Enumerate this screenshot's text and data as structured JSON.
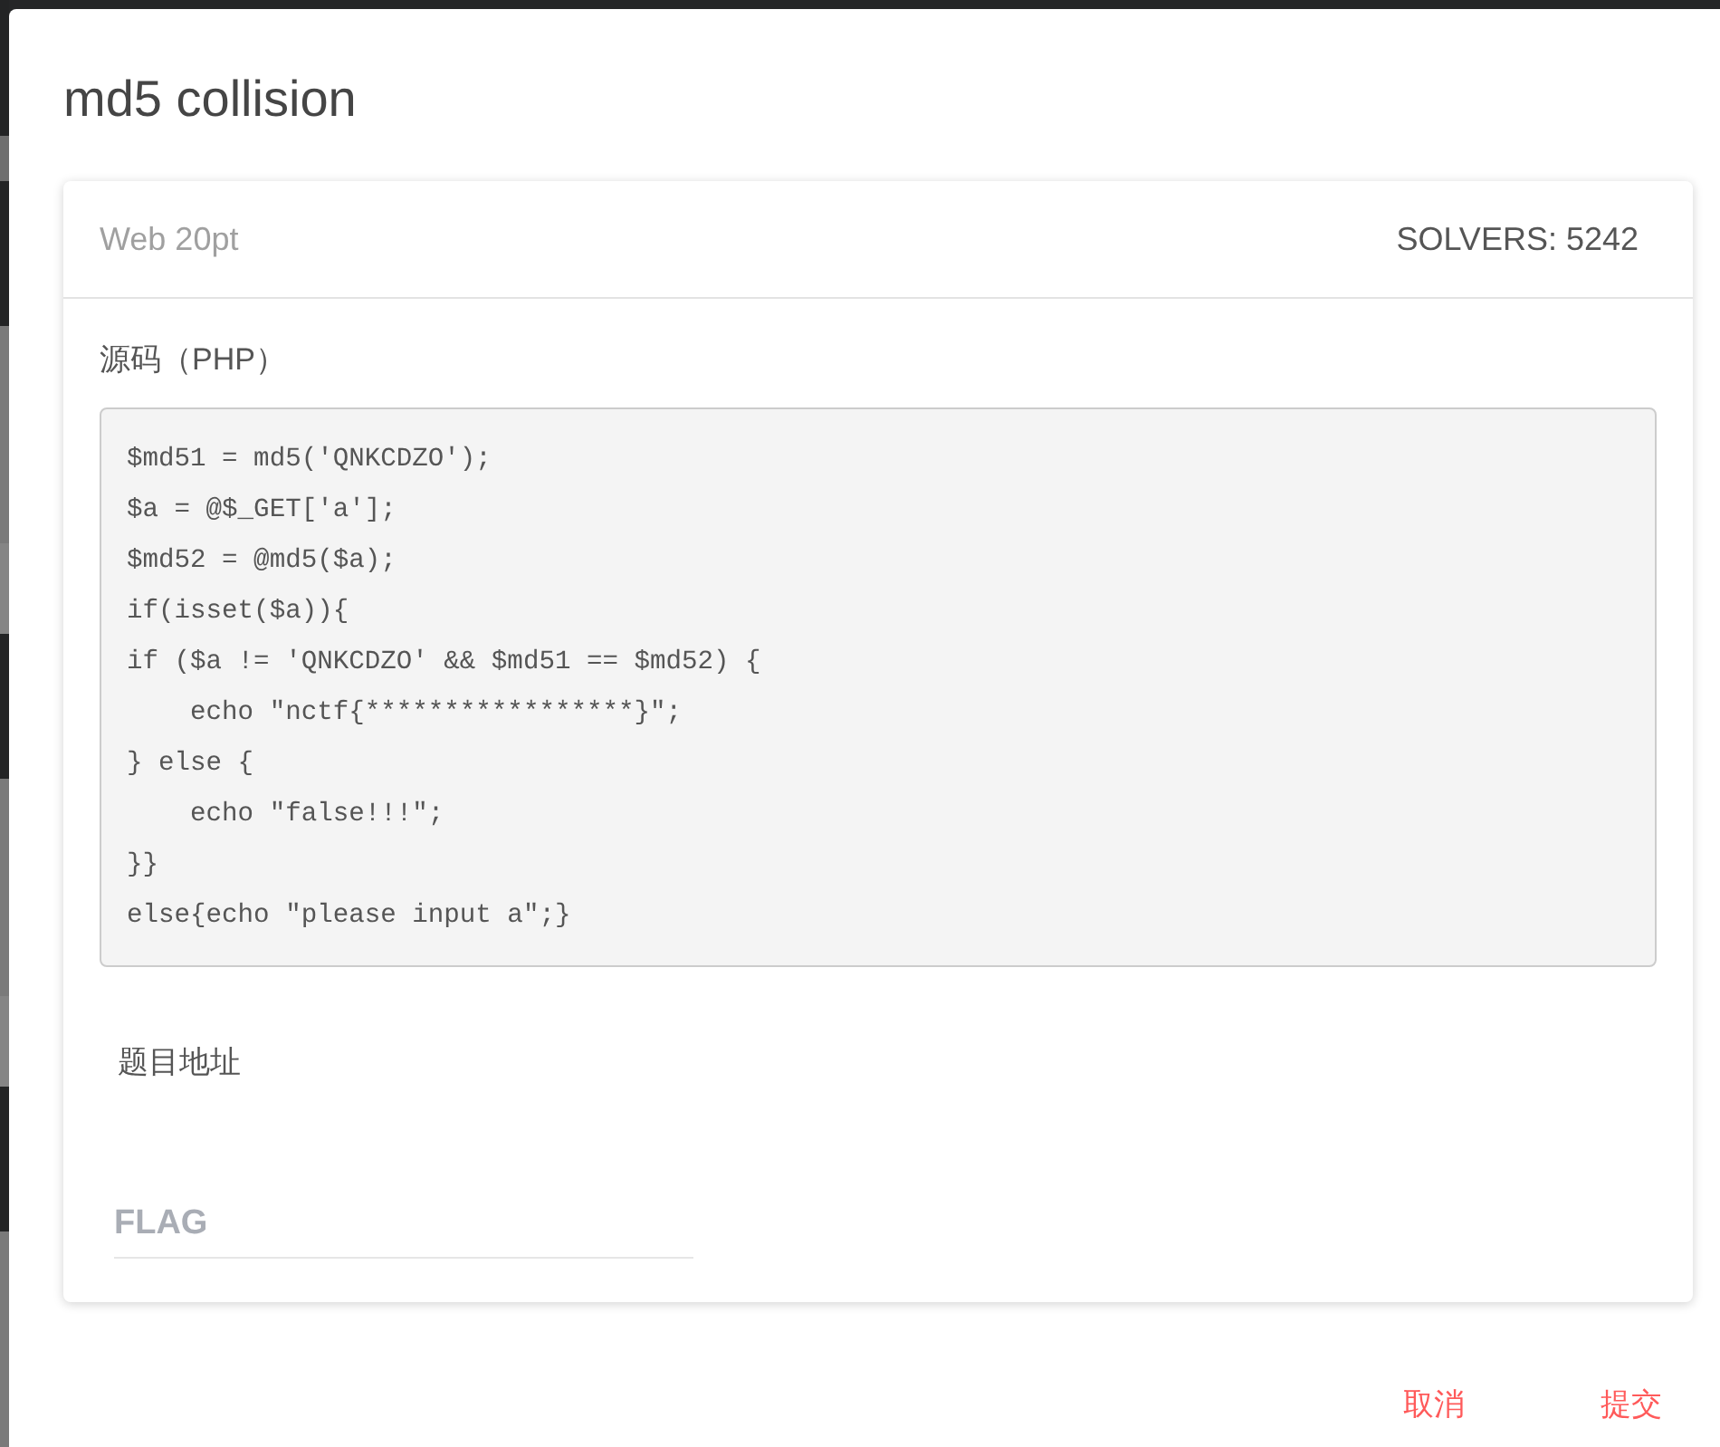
{
  "modal": {
    "title": "md5 collision"
  },
  "card": {
    "category_points": "Web 20pt",
    "solvers": "SOLVERS: 5242"
  },
  "source": {
    "label": "源码（PHP）",
    "code_lines": [
      "$md51 = md5('QNKCDZO');",
      "$a = @$_GET['a'];",
      "$md52 = @md5($a);",
      "if(isset($a)){",
      "if ($a != 'QNKCDZO' && $md51 == $md52) {",
      "    echo \"nctf{*****************}\";",
      "} else {",
      "    echo \"false!!!\";",
      "}}",
      "else{echo \"please input a\";}"
    ]
  },
  "address": {
    "label": "题目地址"
  },
  "flag_field": {
    "placeholder": "FLAG"
  },
  "buttons": [
    "取消",
    "提交"
  ]
}
